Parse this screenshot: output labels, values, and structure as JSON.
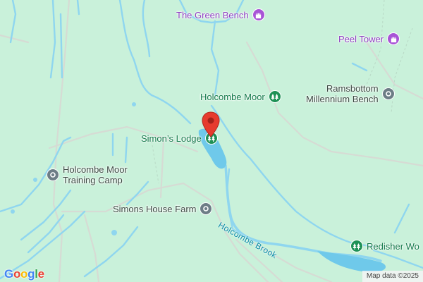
{
  "map": {
    "pois": [
      {
        "id": "the-green-bench",
        "label": "The Green Bench",
        "category": "attraction",
        "color": "#a855d6",
        "icon": "castle-icon"
      },
      {
        "id": "peel-tower",
        "label": "Peel Tower",
        "category": "attraction",
        "color": "#a855d6",
        "icon": "castle-icon"
      },
      {
        "id": "holcombe-moor",
        "label": "Holcombe Moor",
        "category": "park",
        "color": "#1e9156",
        "icon": "tree-icon"
      },
      {
        "id": "ramsbottom-bench",
        "label_line1": "Ramsbottom",
        "label_line2": "Millennium Bench",
        "category": "landmark",
        "color": "#6d7d86",
        "icon": "dot-icon"
      },
      {
        "id": "simons-lodge",
        "label": "Simon’s Lodge",
        "category": "park",
        "color": "#1e9156",
        "icon": "tree-icon"
      },
      {
        "id": "training-camp",
        "label_line1": "Holcombe Moor",
        "label_line2": "Training Camp",
        "category": "landmark",
        "color": "#6d7d86",
        "icon": "dot-icon"
      },
      {
        "id": "simons-house-farm",
        "label": "Simons House Farm",
        "category": "landmark",
        "color": "#6d7d86",
        "icon": "dot-icon"
      },
      {
        "id": "redisher-woods",
        "label": "Redisher Wo",
        "category": "park",
        "color": "#1e9156",
        "icon": "tree-icon"
      }
    ],
    "water_label": "Holcombe Brook",
    "selected_pin": {
      "target": "Simon’s Lodge",
      "color": "#e63b2e",
      "icon": "map-pin-icon"
    },
    "colors": {
      "land": "#c9f1da",
      "water": "#8fd6ef",
      "water_dark": "#5ec1e6",
      "road": "#d9dcd6"
    }
  },
  "footer": {
    "logo": "Google",
    "attribution": "Map data ©2025"
  }
}
